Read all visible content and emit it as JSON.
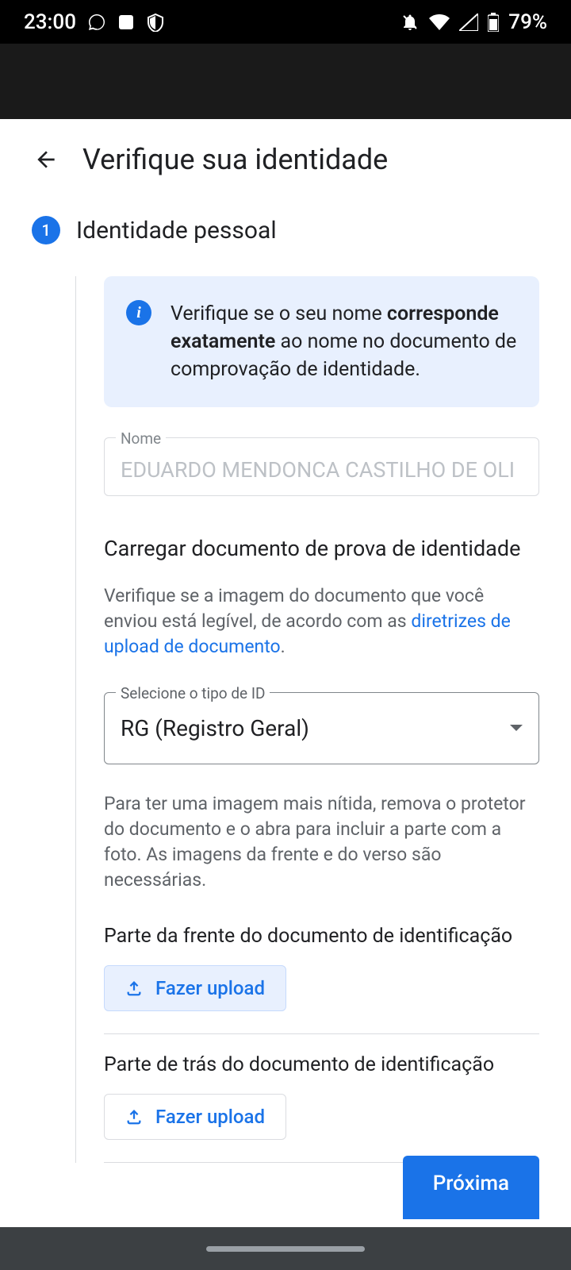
{
  "status": {
    "time": "23:00",
    "battery": "79%"
  },
  "page": {
    "title": "Verifique sua identidade"
  },
  "step": {
    "number": "1",
    "title": "Identidade pessoal"
  },
  "infoBox": {
    "text_before": "Verifique se o seu nome ",
    "text_bold": "corresponde exatamente",
    "text_after": " ao nome no documento de comprovação de identidade."
  },
  "nameField": {
    "label": "Nome",
    "value": "EDUARDO MENDONCA CASTILHO DE OLI"
  },
  "uploadSection": {
    "title": "Carregar documento de prova de identidade",
    "helper_before": "Verifique se a imagem do documento que você enviou está legível, de acordo com as ",
    "helper_link": "diretrizes de upload de documento",
    "helper_after": "."
  },
  "idTypeSelect": {
    "label": "Selecione o tipo de ID",
    "value": "RG (Registro Geral)"
  },
  "idInstructions": "Para ter uma imagem mais nítida, remova o protetor do documento e o abra para incluir a parte com a foto. As imagens da frente e do verso são necessárias.",
  "frontUpload": {
    "title": "Parte da frente do documento de identificação",
    "button": "Fazer upload"
  },
  "backUpload": {
    "title": "Parte de trás do documento de identificação",
    "button": "Fazer upload"
  },
  "nextButton": "Próxima"
}
